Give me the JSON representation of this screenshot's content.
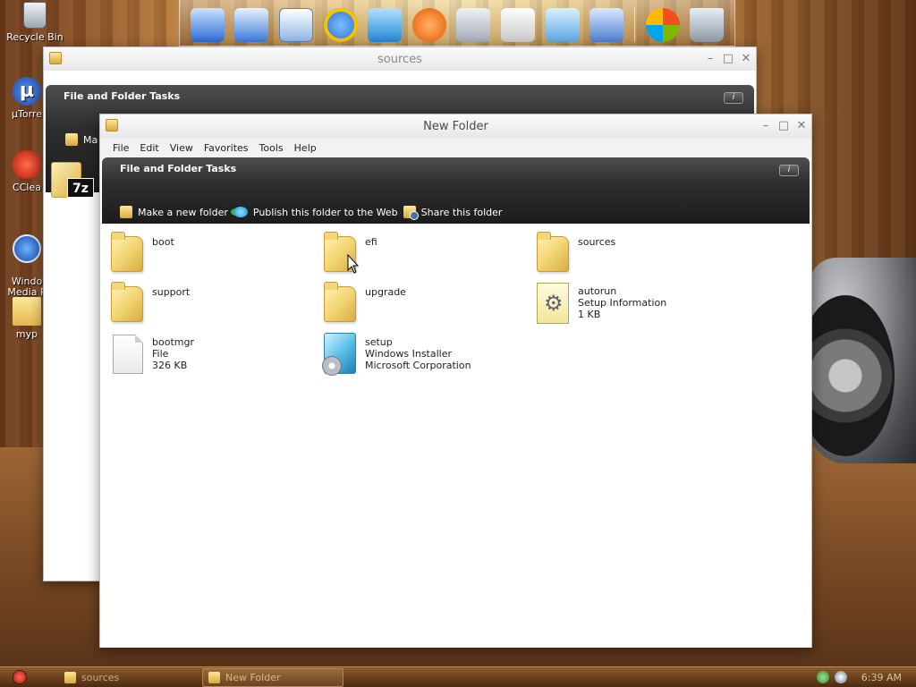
{
  "desktop": {
    "icons": [
      {
        "label": "Recycle Bin",
        "icon": "recycle-bin-icon"
      },
      {
        "label": "µTorre",
        "icon": "utorrent-icon"
      },
      {
        "label": "CClea",
        "icon": "ccleaner-icon"
      },
      {
        "label": "Windo\nMedia P",
        "icon": "windows-media-player-icon"
      },
      {
        "label": "myp",
        "icon": "folder-icon"
      }
    ]
  },
  "dock": {
    "icons": [
      "computer-icon",
      "network-icon",
      "document-icon",
      "internet-explorer-icon",
      "media-center-icon",
      "media-player-icon",
      "calculator-icon",
      "paint-icon",
      "notepad-icon",
      "control-panel-icon",
      "windows-logo-icon",
      "recycle-bin-icon"
    ]
  },
  "back_window": {
    "title": "sources",
    "task_pane_title": "File and Folder Tasks",
    "task_peek": "Ma",
    "info_label": "i",
    "file_badge": "7z"
  },
  "window": {
    "title": "New Folder",
    "menu": [
      "File",
      "Edit",
      "View",
      "Favorites",
      "Tools",
      "Help"
    ],
    "task_pane": {
      "title": "File and Folder Tasks",
      "info_label": "i",
      "actions": [
        {
          "label": "Make a new folder",
          "icon": "new-folder-icon"
        },
        {
          "label": "Publish this folder to the Web",
          "icon": "publish-web-icon"
        },
        {
          "label": "Share this folder",
          "icon": "share-folder-icon"
        }
      ]
    },
    "items": [
      {
        "name": "boot",
        "line2": "",
        "line3": "",
        "type": "folder"
      },
      {
        "name": "efi",
        "line2": "",
        "line3": "",
        "type": "folder"
      },
      {
        "name": "sources",
        "line2": "",
        "line3": "",
        "type": "folder"
      },
      {
        "name": "support",
        "line2": "",
        "line3": "",
        "type": "folder"
      },
      {
        "name": "upgrade",
        "line2": "",
        "line3": "",
        "type": "folder"
      },
      {
        "name": "autorun",
        "line2": "Setup Information",
        "line3": "1 KB",
        "type": "inf"
      },
      {
        "name": "bootmgr",
        "line2": "File",
        "line3": "326 KB",
        "type": "file"
      },
      {
        "name": "setup",
        "line2": "Windows Installer",
        "line3": "Microsoft Corporation",
        "type": "exe"
      }
    ]
  },
  "taskbar": {
    "buttons": [
      {
        "label": "sources",
        "active": false
      },
      {
        "label": "New Folder",
        "active": true
      }
    ],
    "clock": "6:39 AM"
  }
}
